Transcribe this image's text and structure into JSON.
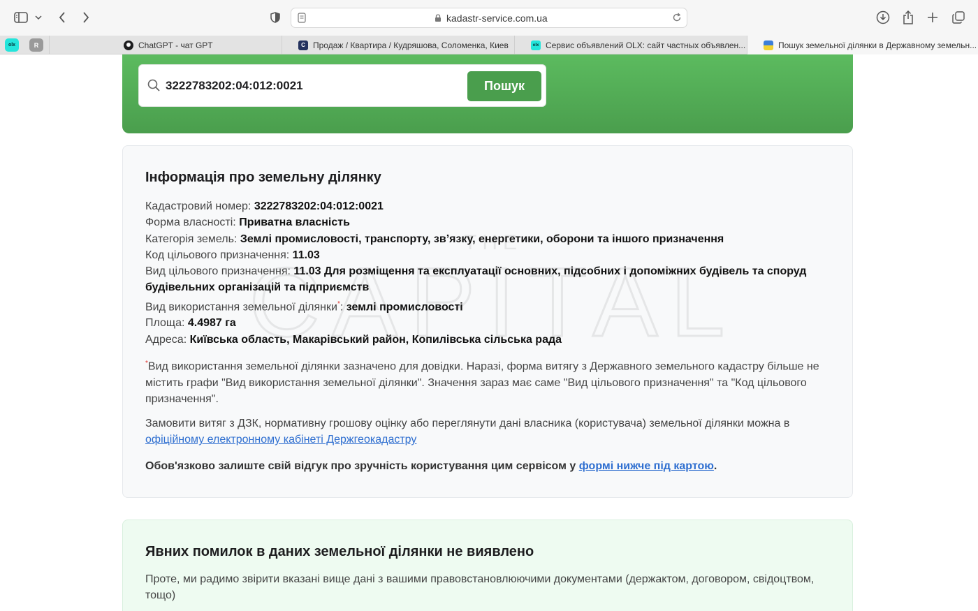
{
  "browser": {
    "url": "kadastr-service.com.ua",
    "pinned_tabs": [
      {
        "name": "olx",
        "letter": "OLX",
        "color": "#23e5db"
      },
      {
        "name": "r",
        "letter": "R",
        "color": "#9a9a9a"
      }
    ],
    "tabs": [
      {
        "title": "ChatGPT - чат GPT",
        "active": false
      },
      {
        "title": "Продаж / Квартира / Кудряшова, Соломенка, Киев",
        "active": false
      },
      {
        "title": "Сервис объявлений OLX: сайт частных объявлен...",
        "active": false
      },
      {
        "title": "Пошук земельної ділянки в Державному земельн...",
        "active": true
      }
    ]
  },
  "search": {
    "value": "3222783202:04:012:0021",
    "button_label": "Пошук"
  },
  "info": {
    "title": "Інформація про земельну ділянку",
    "fields": [
      {
        "label": "Кадастровий номер:",
        "value": "3222783202:04:012:0021"
      },
      {
        "label": "Форма власності:",
        "value": "Приватна власність"
      },
      {
        "label": "Категорія земель:",
        "value": "Землі промисловості, транспорту, зв’язку, енергетики, оборони та іншого призначення"
      },
      {
        "label": "Код цільового призначення:",
        "value": "11.03"
      },
      {
        "label": "Вид цільового призначення:",
        "value_code": "11.03",
        "value": "Для розміщення та експлуатації основних, підсобних і допоміжних будівель та споруд будівельних організацій та підприємств"
      },
      {
        "label": "Вид використання земельної ділянки",
        "asterisk": "*",
        "value": "землі промисловості"
      },
      {
        "label": "Площа:",
        "value": "4.4987 га"
      },
      {
        "label": "Адреса:",
        "value": "Київська область, Макарівський район, Копилівська сільська рада"
      }
    ],
    "footnote_mark": "*",
    "footnote": "Вид використання земельної ділянки зазначено для довідки. Наразі, форма витягу з Державного земельного кадастру більше не містить графи \"Вид використання земельної ділянки\". Значення зараз має саме \"Вид цільового призначення\" та \"Код цільового призначення\".",
    "order_text": "Замовити витяг з ДЗК, нормативну грошову оцінку або переглянути дані власника (користувача) земельної ділянки можна в",
    "order_link": "офіційному електронному кабінеті Держгеокадастру",
    "feedback_text": "Обов'язково залиште свій відгук про зручність користування цим сервісом у",
    "feedback_link": "формі нижче під картою",
    "feedback_end": "."
  },
  "status": {
    "title": "Явних помилок в даних земельної ділянки не виявлено",
    "text": "Проте, ми радимо звірити вказані вище дані з вашими правовстановлюючими документами (держактом, договором, свідоцтвом, тощо)"
  },
  "colors": {
    "accent_green": "#4a9e4d",
    "link_blue": "#2f6fd0",
    "asterisk_red": "#e0342e"
  }
}
